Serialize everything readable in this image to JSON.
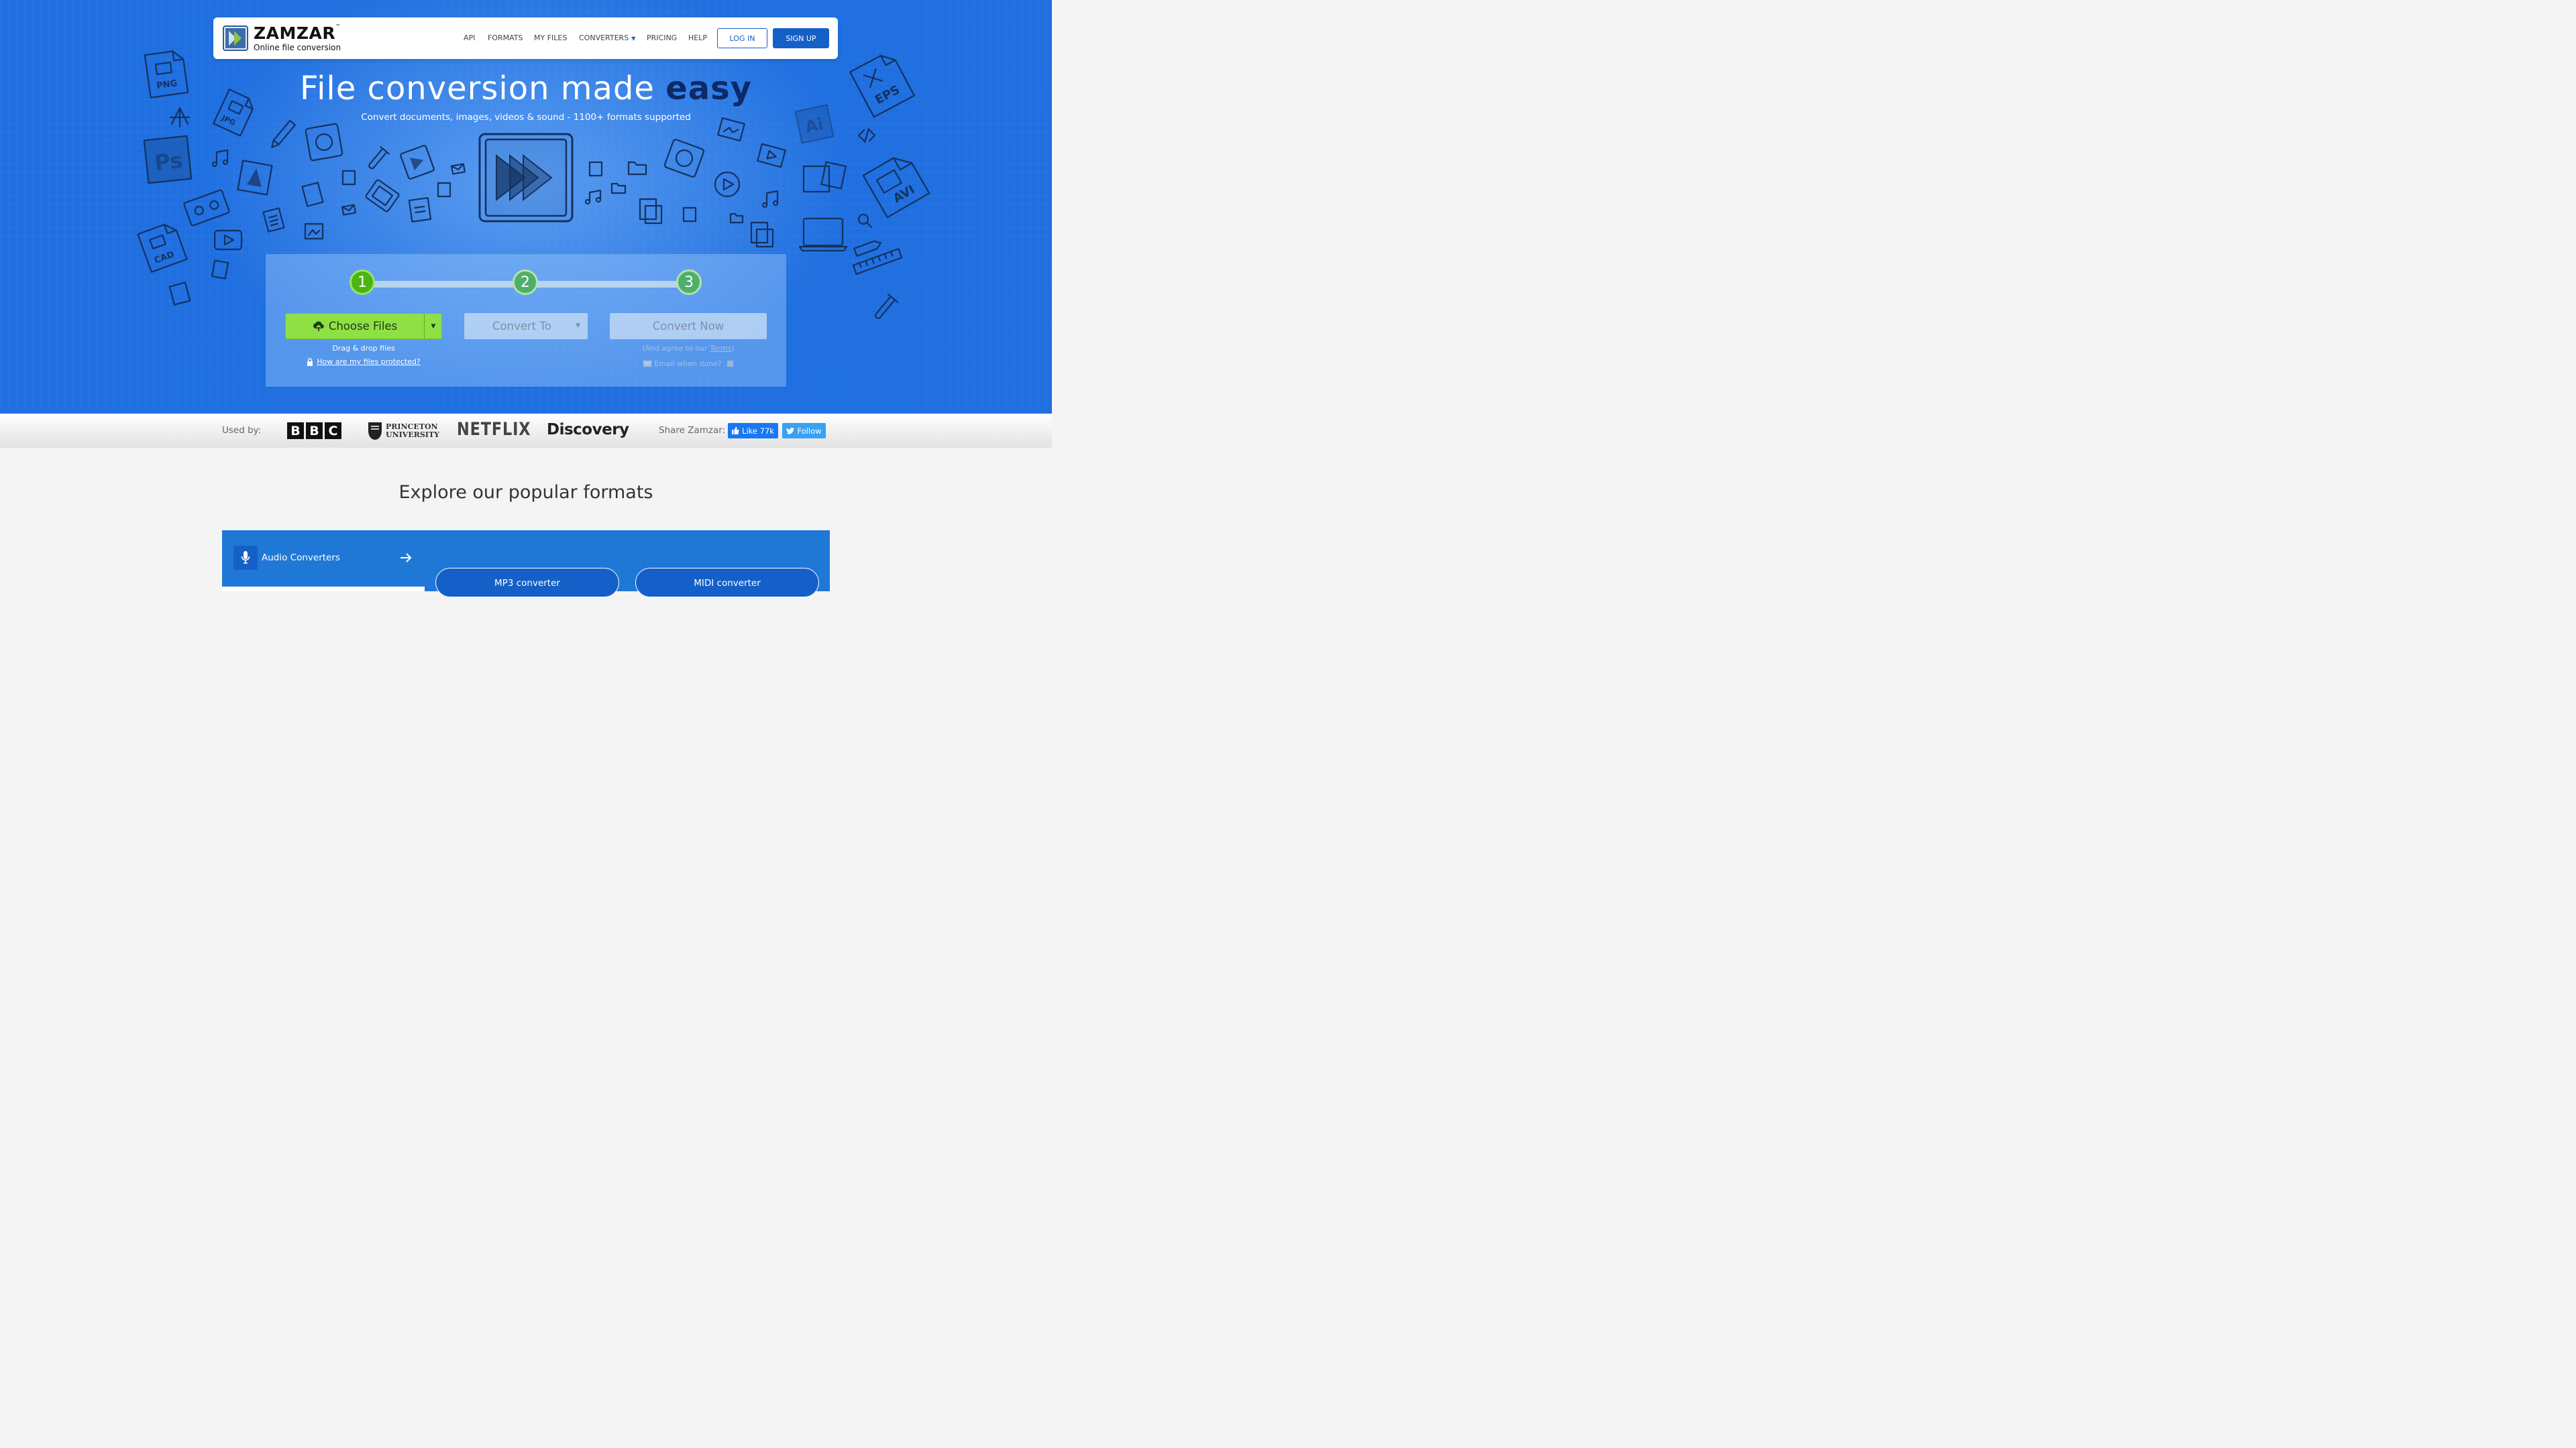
{
  "brand": {
    "name": "ZAMZAR",
    "trademark": "™",
    "tagline": "Online file conversion",
    "colors": {
      "primary": "#1560c8",
      "hero_bg": "#1f6fe0",
      "accent_green": "#8ee045",
      "step_green": "#4bb513"
    }
  },
  "nav": {
    "items": [
      {
        "label": "API"
      },
      {
        "label": "FORMATS"
      },
      {
        "label": "MY FILES"
      },
      {
        "label": "CONVERTERS",
        "has_dropdown": true
      },
      {
        "label": "PRICING"
      },
      {
        "label": "HELP"
      }
    ],
    "login": "LOG IN",
    "signup": "SIGN UP"
  },
  "hero": {
    "headline_start": "File conversion made ",
    "headline_emphasis": "easy",
    "subheadline": "Convert documents, images, videos & sound - 1100+ formats supported",
    "icon_labels": [
      "PNG",
      "JPG",
      "Ps",
      "CAD",
      "EPS",
      "Ai",
      "AVI"
    ]
  },
  "converter": {
    "steps": [
      "1",
      "2",
      "3"
    ],
    "active_step": 1,
    "choose_files": "Choose Files",
    "convert_to": "Convert To",
    "convert_now": "Convert Now",
    "drag_drop": "Drag & drop files",
    "protected_link": "How are my files protected?",
    "agree_prefix": "(And agree to our ",
    "terms_link": "Terms",
    "agree_suffix": ")",
    "email_label": "Email when done?"
  },
  "used_by": {
    "label": "Used by:",
    "logos": {
      "bbc": [
        "B",
        "B",
        "C"
      ],
      "princeton_line1": "PRINCETON",
      "princeton_line2": "UNIVERSITY",
      "netflix": "NETFLIX",
      "discovery": "Discovery"
    }
  },
  "share": {
    "label": "Share Zamzar:",
    "facebook": "Like 77k",
    "twitter": "Follow"
  },
  "explore": {
    "title": "Explore our popular formats",
    "active_category": "Audio Converters",
    "converters": [
      "MP3 converter",
      "MIDI converter"
    ]
  }
}
